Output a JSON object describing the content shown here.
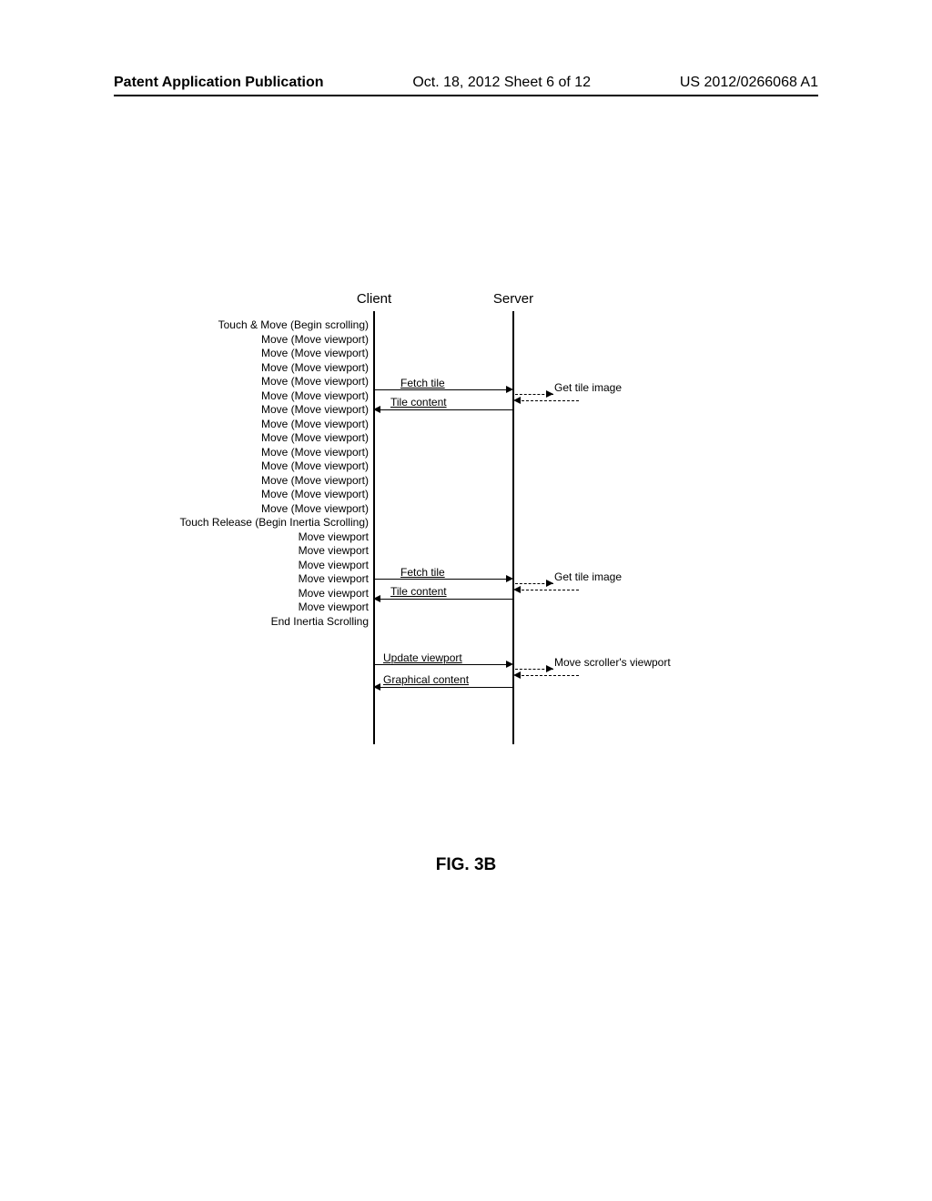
{
  "header": {
    "left": "Patent Application Publication",
    "center": "Oct. 18, 2012  Sheet 6 of 12",
    "right": "US 2012/0266068 A1"
  },
  "diagram": {
    "client_label": "Client",
    "server_label": "Server",
    "client_events": [
      "Touch & Move (Begin scrolling)",
      "Move (Move viewport)",
      "Move (Move viewport)",
      "Move (Move viewport)",
      "Move (Move viewport)",
      "Move (Move viewport)",
      "Move (Move viewport)",
      "Move (Move viewport)",
      "Move (Move viewport)",
      "Move (Move viewport)",
      "Move (Move viewport)",
      "Move (Move viewport)",
      "Move (Move viewport)",
      "Move (Move viewport)",
      "Touch Release (Begin Inertia Scrolling)",
      "Move viewport",
      "Move viewport",
      "Move viewport",
      "Move viewport",
      "Move viewport",
      "Move viewport",
      "End Inertia Scrolling"
    ],
    "messages": {
      "fetch_tile_1": "Fetch tile",
      "tile_content_1": "Tile content",
      "get_tile_1": "Get tile image",
      "fetch_tile_2": "Fetch tile",
      "tile_content_2": "Tile content",
      "get_tile_2": "Get tile image",
      "update_viewport": "Update viewport",
      "graphical_content": "Graphical content",
      "move_scroller": "Move scroller's viewport"
    }
  },
  "figure_caption": "FIG. 3B"
}
